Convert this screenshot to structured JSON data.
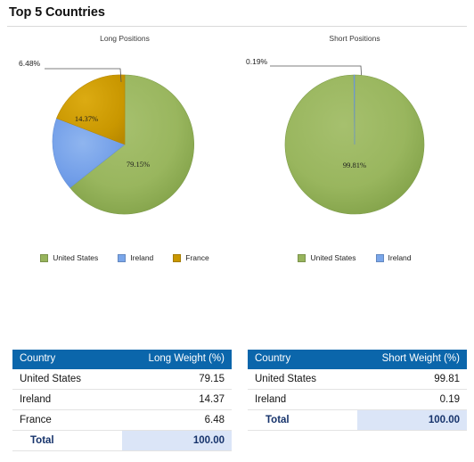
{
  "header": {
    "title": "Top 5 Countries"
  },
  "colors": {
    "united_states": "#97b45c",
    "ireland": "#7aa6ea",
    "france": "#c99700",
    "table_header": "#0b66ab",
    "total_highlight": "#dbe5f7",
    "total_text": "#16336b"
  },
  "charts": [
    {
      "id": "long",
      "subtitle": "Long Positions",
      "callout": "6.48%",
      "legend": [
        {
          "label": "United States",
          "color": "#97b45c"
        },
        {
          "label": "Ireland",
          "color": "#7aa6ea"
        },
        {
          "label": "France",
          "color": "#c99700"
        }
      ],
      "inner_labels": [
        "14.37%",
        "79.15%"
      ]
    },
    {
      "id": "short",
      "subtitle": "Short Positions",
      "callout": "0.19%",
      "legend": [
        {
          "label": "United States",
          "color": "#97b45c"
        },
        {
          "label": "Ireland",
          "color": "#7aa6ea"
        }
      ],
      "inner_labels": [
        "99.81%"
      ]
    }
  ],
  "chart_data": [
    {
      "type": "pie",
      "title": "Long Positions",
      "categories": [
        "United States",
        "Ireland",
        "France"
      ],
      "values": [
        79.15,
        14.37,
        6.48
      ],
      "value_labels": [
        "79.15%",
        "14.37%",
        "6.48%"
      ],
      "colors": [
        "#97b45c",
        "#7aa6ea",
        "#c99700"
      ],
      "legend_position": "bottom",
      "units": "percent",
      "total": 100.0
    },
    {
      "type": "pie",
      "title": "Short Positions",
      "categories": [
        "United States",
        "Ireland"
      ],
      "values": [
        99.81,
        0.19
      ],
      "value_labels": [
        "99.81%",
        "0.19%"
      ],
      "colors": [
        "#97b45c",
        "#7aa6ea"
      ],
      "legend_position": "bottom",
      "units": "percent",
      "total": 100.0
    }
  ],
  "tables": {
    "long": {
      "headers": {
        "country": "Country",
        "weight": "Long Weight (%)"
      },
      "rows": [
        {
          "country": "United States",
          "weight": "79.15"
        },
        {
          "country": "Ireland",
          "weight": "14.37"
        },
        {
          "country": "France",
          "weight": "6.48"
        }
      ],
      "total": {
        "label": "Total",
        "value": "100.00"
      }
    },
    "short": {
      "headers": {
        "country": "Country",
        "weight": "Short Weight (%)"
      },
      "rows": [
        {
          "country": "United States",
          "weight": "99.81"
        },
        {
          "country": "Ireland",
          "weight": "0.19"
        }
      ],
      "total": {
        "label": "Total",
        "value": "100.00"
      }
    }
  }
}
